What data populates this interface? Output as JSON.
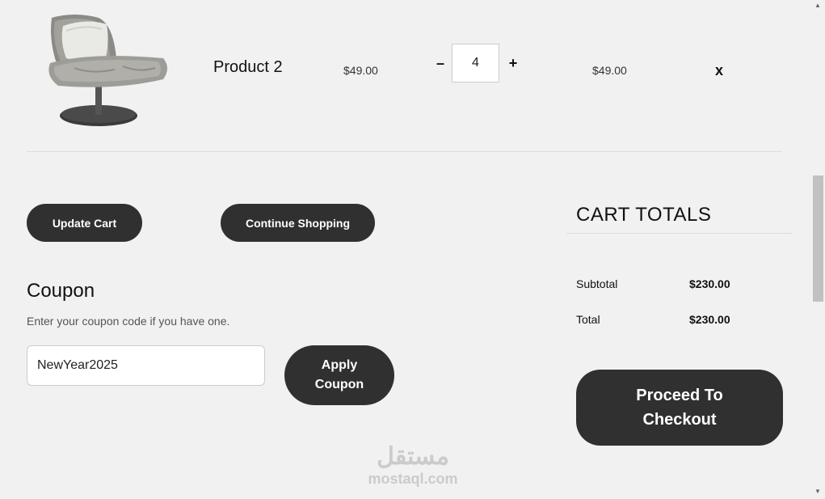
{
  "cart_row": {
    "product_name": "Product 2",
    "price": "$49.00",
    "quantity": "4",
    "minus_label": "–",
    "plus_label": "+",
    "line_total": "$49.00",
    "remove_label": "x",
    "image_icon": "lounge-chair-image"
  },
  "actions": {
    "update_cart": "Update Cart",
    "continue_shopping": "Continue Shopping"
  },
  "coupon": {
    "title": "Coupon",
    "description": "Enter your coupon code if you have one.",
    "code_value": "NewYear2025",
    "apply_line1": "Apply",
    "apply_line2": "Coupon"
  },
  "cart_totals": {
    "title": "CART TOTALS",
    "subtotal_label": "Subtotal",
    "subtotal_value": "$230.00",
    "total_label": "Total",
    "total_value": "$230.00",
    "checkout_line1": "Proceed To",
    "checkout_line2": "Checkout"
  },
  "watermark": {
    "logo_text": "مستقل",
    "domain": "mostaql.com"
  },
  "colors": {
    "background": "#f0f1f0",
    "button": "#303030",
    "button_text": "#ffffff"
  }
}
